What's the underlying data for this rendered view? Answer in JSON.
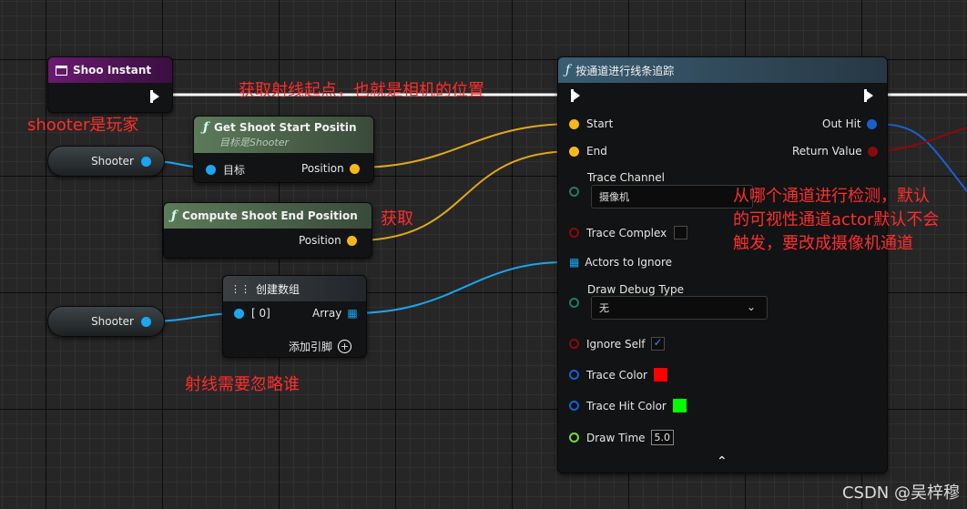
{
  "event_node": {
    "title": "Shoo Instant"
  },
  "get_start_node": {
    "title": "Get Shoot Start Positin",
    "subtitle": "目标是Shooter",
    "target_label": "目标",
    "output_label": "Position"
  },
  "compute_end_node": {
    "title": "Compute Shoot End Position",
    "output_label": "Position"
  },
  "make_array_node": {
    "title": "创建数组",
    "input_label": "[ 0]",
    "output_label": "Array",
    "add_pin_label": "添加引脚"
  },
  "shooter_vars": [
    "Shooter",
    "Shooter"
  ],
  "trace_node": {
    "title": "按通道进行线条追踪",
    "inputs": {
      "start": "Start",
      "end": "End",
      "trace_channel": "Trace Channel",
      "trace_channel_value": "摄像机",
      "trace_complex": "Trace Complex",
      "actors_to_ignore": "Actors to Ignore",
      "draw_debug_type": "Draw Debug Type",
      "draw_debug_value": "无",
      "ignore_self": "Ignore Self",
      "trace_color": "Trace Color",
      "trace_hit_color": "Trace Hit Color",
      "draw_time": "Draw Time",
      "draw_time_value": "5.0"
    },
    "outputs": {
      "out_hit": "Out Hit",
      "return_value": "Return Value"
    }
  },
  "annotations": {
    "exec_note": "获取射线起点，也就是相机的位置",
    "shooter_note": "shooter是玩家",
    "get_note": "获取",
    "channel_note_line1": "从哪个通道进行检测，默认",
    "channel_note_line2": "的可视性通道actor默认不会",
    "channel_note_line3": "触发，要改成摄像机通道",
    "ignore_note": "射线需要忽略谁"
  },
  "watermark": "CSDN @吴梓穆",
  "colors": {
    "vector_pin": "#f7b81a",
    "object_pin": "#1aa6f0",
    "bool_pin": "#8a0a0a",
    "byte_pin": "#1f7a6a",
    "struct_pin": "#1a5fd0",
    "float_pin": "#7ad63a",
    "trace_color": "#ff0000",
    "trace_hit_color": "#00ff00",
    "annotation": "#ff2d2d"
  }
}
